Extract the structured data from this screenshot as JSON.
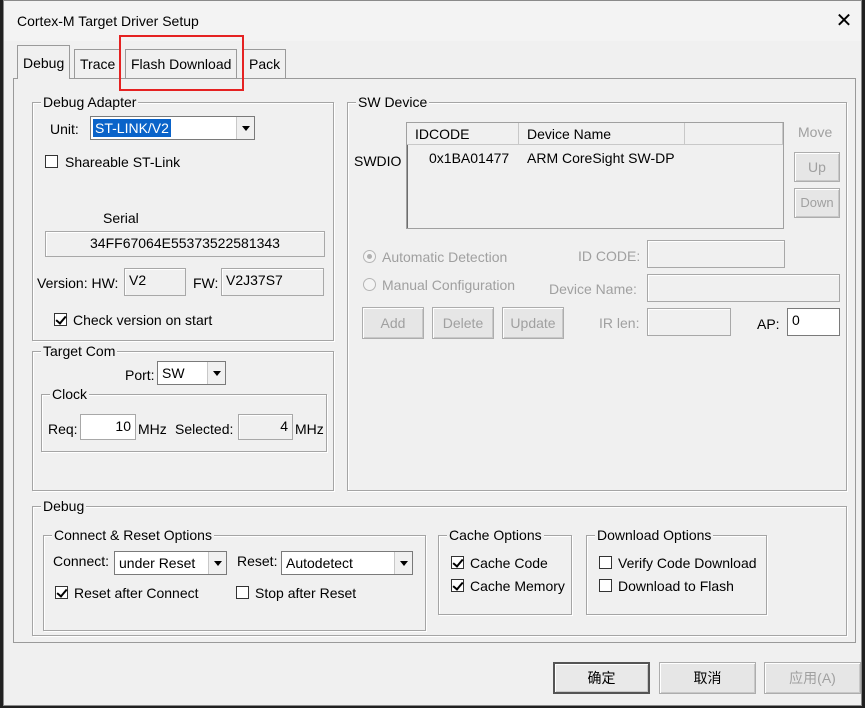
{
  "window": {
    "title": "Cortex-M Target Driver Setup"
  },
  "tabs": [
    {
      "label": "Debug",
      "active": true
    },
    {
      "label": "Trace"
    },
    {
      "label": "Flash Download",
      "highlighted": true
    },
    {
      "label": "Pack"
    }
  ],
  "highlight_color": "#e52222",
  "debug_adapter": {
    "legend": "Debug Adapter",
    "unit_label": "Unit:",
    "unit_value": "ST-LINK/V2",
    "shareable_label": "Shareable ST-Link",
    "shareable_checked": false,
    "serial_label": "Serial",
    "serial_value": "34FF67064E55373522581343",
    "version_label": "Version: HW:",
    "hw_value": "V2",
    "fw_label": "FW:",
    "fw_value": "V2J37S7",
    "check_version_label": "Check version on start",
    "check_version_checked": true
  },
  "target_com": {
    "legend": "Target Com",
    "port_label": "Port:",
    "port_value": "SW",
    "clock_legend": "Clock",
    "req_label": "Req:",
    "req_value": "10",
    "req_unit": "MHz",
    "selected_label": "Selected:",
    "selected_value": "4",
    "selected_unit": "MHz"
  },
  "sw_device": {
    "legend": "SW Device",
    "columns": [
      "IDCODE",
      "Device Name"
    ],
    "row_label": "SWDIO",
    "rows": [
      {
        "idcode": "0x1BA01477",
        "device_name": "ARM CoreSight SW-DP"
      }
    ],
    "move_label": "Move",
    "up_label": "Up",
    "down_label": "Down",
    "auto_detect_label": "Automatic Detection",
    "manual_config_label": "Manual Configuration",
    "id_code_label": "ID CODE:",
    "device_name_label": "Device Name:",
    "ir_len_label": "IR len:",
    "ap_label": "AP:",
    "ap_value": "0",
    "add_label": "Add",
    "delete_label": "Delete",
    "update_label": "Update"
  },
  "debug": {
    "legend": "Debug",
    "connect_reset": {
      "legend": "Connect & Reset Options",
      "connect_label": "Connect:",
      "connect_value": "under Reset",
      "reset_label": "Reset:",
      "reset_value": "Autodetect",
      "reset_after_connect_label": "Reset after Connect",
      "reset_after_connect_checked": true,
      "stop_after_reset_label": "Stop after Reset",
      "stop_after_reset_checked": false
    },
    "cache_options": {
      "legend": "Cache Options",
      "cache_code_label": "Cache Code",
      "cache_code_checked": true,
      "cache_memory_label": "Cache Memory",
      "cache_memory_checked": true
    },
    "download_options": {
      "legend": "Download Options",
      "verify_label": "Verify Code Download",
      "verify_checked": false,
      "download_flash_label": "Download to Flash",
      "download_flash_checked": false
    }
  },
  "buttons": {
    "ok": "确定",
    "cancel": "取消",
    "apply": "应用(A)"
  }
}
